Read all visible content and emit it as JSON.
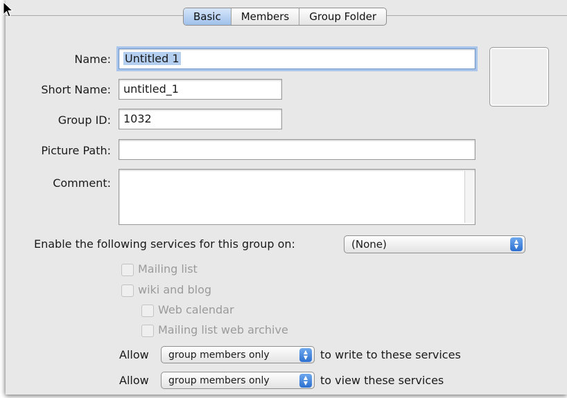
{
  "tabs": {
    "basic": "Basic",
    "members": "Members",
    "group_folder": "Group Folder"
  },
  "form": {
    "name_label": "Name:",
    "name_value": "Untitled 1",
    "short_name_label": "Short Name:",
    "short_name_value": "untitled_1",
    "group_id_label": "Group ID:",
    "group_id_value": "1032",
    "picture_path_label": "Picture Path:",
    "picture_path_value": "",
    "comment_label": "Comment:",
    "comment_value": ""
  },
  "services": {
    "enable_label": "Enable the following services for this group on:",
    "enable_value": "(None)",
    "mailing_list": "Mailing list",
    "wiki_blog": "wiki and blog",
    "web_calendar": "Web calendar",
    "mailing_archive": "Mailing list web archive"
  },
  "permissions": {
    "allow_label": "Allow",
    "write_value": "group members only",
    "write_suffix": "to write to these services",
    "view_value": "group members only",
    "view_suffix": "to view these services"
  },
  "colors": {
    "accent_blue": "#2b6fd0",
    "focus_ring": "#a9c6ea",
    "pane_bg": "#e8e8e8"
  }
}
